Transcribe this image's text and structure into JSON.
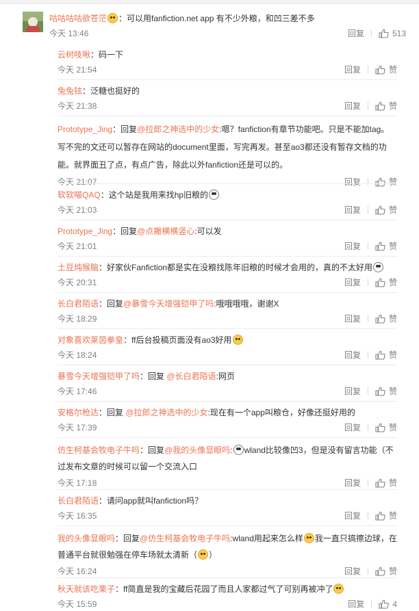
{
  "main_comment": {
    "username": "咕咕咕咕欲苍茫",
    "text": "：可以用fanfiction.net app 有不少外粮，和凹三差不多",
    "time": "今天 13:46",
    "reply_label": "回复",
    "like_count": "513"
  },
  "replies": [
    {
      "username": "云树吱啾",
      "text": "：码一下",
      "time": "今天 21:54",
      "reply_label": "回复",
      "like_label": "赞"
    },
    {
      "username": "兔兔铉",
      "text": "：泛糖也挺好的",
      "time": "今天 21:38",
      "reply_label": "回复",
      "like_label": "赞"
    },
    {
      "username": "Prototype_Jing",
      "prefix": "：回复",
      "mention": "@拉郎之神选中的少女",
      "text": ":嗯？fanfiction有章节功能吧。只是不能加tag。写不完的文还可以暂存在网站的document里面，写完再发。甚至ao3都还没有暂存文档的功能。就界面丑了点，有点广告，除此以外fanfiction还是可以的。",
      "time": "今天 21:07",
      "reply_label": "回复",
      "like_label": "赞"
    },
    {
      "username": "软软喵QAQ",
      "text": "：这个站是我用来找hp旧粮的",
      "time": "今天 21:03",
      "reply_label": "回复",
      "like_label": "赞"
    },
    {
      "username": "Prototype_Jing",
      "prefix": "：回复",
      "mention": "@点撇横横竖心",
      "text": ":可以发",
      "time": "今天 21:01",
      "reply_label": "回复",
      "like_label": "赞"
    },
    {
      "username": "土豆炖猴脑",
      "text": "：好家伙Fanfiction都是实在没粮找陈年旧粮的时候才会用的，真的不太好用",
      "time": "今天 20:31",
      "reply_label": "回复",
      "like_label": "赞"
    },
    {
      "username": "长白君陌语",
      "prefix": "：回复",
      "mention": "@暴雪今天增强铠甲了吗",
      "text": ":哦哦哦哦，谢谢X",
      "time": "今天 18:29",
      "reply_label": "回复",
      "like_label": "赞"
    },
    {
      "username": "对象喜欢莱茵拳皇",
      "text": "：ff后台投稿页面没有ao3好用",
      "time": "今天 18:24",
      "reply_label": "回复",
      "like_label": "赞"
    },
    {
      "username": "暴雪今天增强铠甲了吗",
      "prefix": "：回复 ",
      "mention": "@长白君陌语",
      "text": ":网页",
      "time": "今天 17:46",
      "reply_label": "回复",
      "like_label": "赞"
    },
    {
      "username": "安格尔枪达",
      "prefix": "：回复 ",
      "mention": "@拉郎之神选中的少女",
      "text": ":现在有一个app叫粮仓，好像还挺好用的",
      "time": "今天 17:39",
      "reply_label": "回复",
      "like_label": "赞"
    },
    {
      "username": "仿生柯基会牧电子牛吗",
      "prefix": "：回复",
      "mention": "@我的头像显眼吗",
      "text": ":",
      "text2": "wland比较像凹3，但是没有留言功能（不过发布文章的时候可以留一个交流入口",
      "time": "今天 17:18",
      "reply_label": "回复",
      "like_label": "赞"
    },
    {
      "username": "长白君陌语",
      "text": "：请问app就叫fanfiction吗？",
      "time": "今天 16:35",
      "reply_label": "回复",
      "like_label": "赞"
    },
    {
      "username": "我的头像显眼吗",
      "prefix": "：回复",
      "mention": "@仿生柯基会牧电子牛吗",
      "text": ":wland用起来怎么样",
      "text2": "我一直只搞擦边球，在普通平台就很勉强在停车场就太清新（",
      "text3": "）",
      "time": "今天 16:24",
      "reply_label": "回复",
      "like_label": "赞"
    },
    {
      "username": "秋天就该吃栗子",
      "text": "：ff简直是我的宝藏后花园了而且人家都过气了可别再被冲了",
      "time": "今天 15:59",
      "reply_label": "回复",
      "like_count": "4"
    }
  ],
  "icons": {
    "like": "thumbs-up-icon",
    "emoji": "emoji-icon"
  },
  "colors": {
    "username": "#eb7350",
    "meta": "#808080",
    "text": "#333333"
  }
}
